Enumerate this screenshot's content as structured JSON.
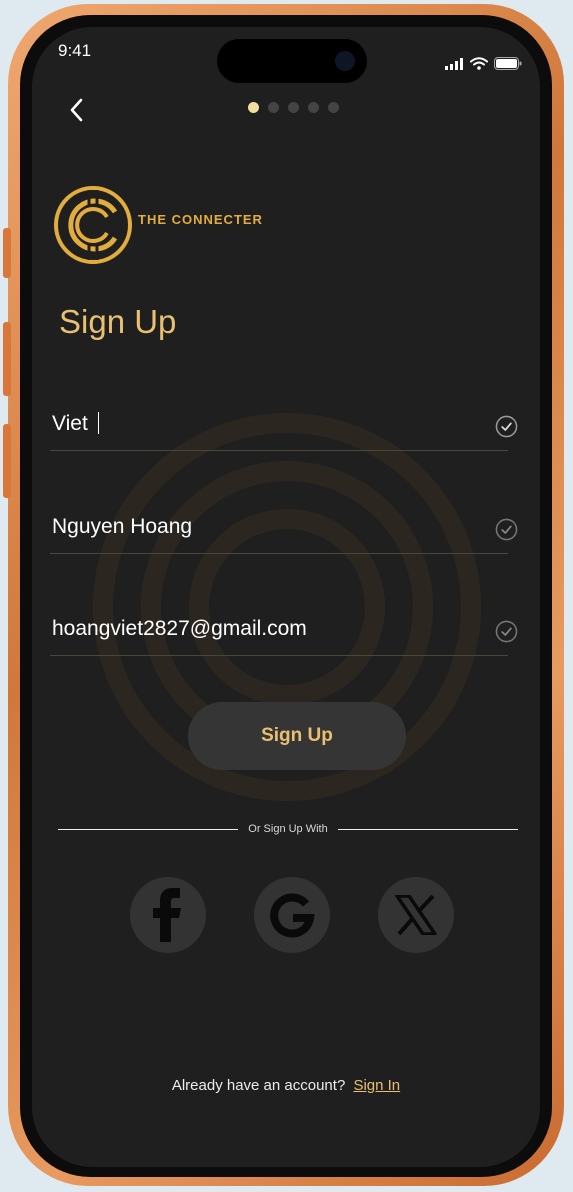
{
  "status_bar": {
    "time": "9:41"
  },
  "progress": {
    "total_steps": 5,
    "current_step": 1
  },
  "brand": {
    "name": "THE CONNECTER"
  },
  "form": {
    "title": "Sign Up",
    "fields": [
      {
        "value": "Viet",
        "focused": true,
        "valid": true
      },
      {
        "value": "Nguyen Hoang",
        "focused": false,
        "valid": true
      },
      {
        "value": "hoangviet2827@gmail.com",
        "focused": false,
        "valid": true
      }
    ],
    "submit_label": "Sign Up"
  },
  "social": {
    "divider_label": "Or Sign Up With",
    "providers": [
      "facebook-icon",
      "google-icon",
      "x-icon"
    ]
  },
  "footer": {
    "prompt": "Already have an account?",
    "link_label": "Sign In"
  },
  "colors": {
    "accent": "#e8c070",
    "logo_gold": "#e3ad3d",
    "background": "#1f1f1f",
    "frame": "#d9773a"
  }
}
